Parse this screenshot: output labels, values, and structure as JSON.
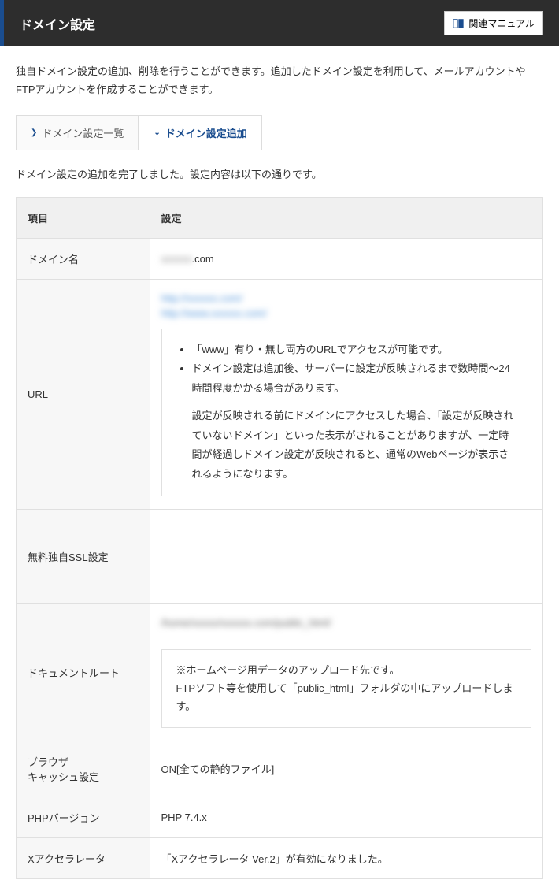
{
  "header": {
    "title": "ドメイン設定",
    "manual_button": "関連マニュアル"
  },
  "description": "独自ドメイン設定の追加、削除を行うことができます。追加したドメイン設定を利用して、メールアカウントやFTPアカウントを作成することができます。",
  "tabs": {
    "list": "ドメイン設定一覧",
    "add": "ドメイン設定追加"
  },
  "complete_message": "ドメイン設定の追加を完了しました。設定内容は以下の通りです。",
  "table": {
    "header_item": "項目",
    "header_setting": "設定",
    "domain_name_label": "ドメイン名",
    "domain_name_value_blurred": "xxxxxx",
    "domain_name_value_suffix": ".com",
    "url_label": "URL",
    "url_link1": "http://xxxxxx.com/",
    "url_link2": "http://www.xxxxxx.com/",
    "url_note1": "「www」有り・無し両方のURLでアクセスが可能です。",
    "url_note2": "ドメイン設定は追加後、サーバーに設定が反映されるまで数時間～24時間程度かかる場合があります。",
    "url_note3": "設定が反映される前にドメインにアクセスした場合、「設定が反映されていないドメイン」といった表示がされることがありますが、一定時間が経過しドメイン設定が反映されると、通常のWebページが表示されるようになります。",
    "ssl_label": "無料独自SSL設定",
    "ssl_value": "",
    "docroot_label": "ドキュメントルート",
    "docroot_path_blurred": "/home/xxxxx/xxxxxx.com/public_html/",
    "docroot_note1": "※ホームページ用データのアップロード先です。",
    "docroot_note2": "FTPソフト等を使用して「public_html」フォルダの中にアップロードします。",
    "cache_label1": "ブラウザ",
    "cache_label2": "キャッシュ設定",
    "cache_value": "ON[全ての静的ファイル]",
    "php_label": "PHPバージョン",
    "php_value": "PHP 7.4.x",
    "xaccel_label": "Xアクセラレータ",
    "xaccel_value": "「Xアクセラレータ Ver.2」が有効になりました。"
  }
}
